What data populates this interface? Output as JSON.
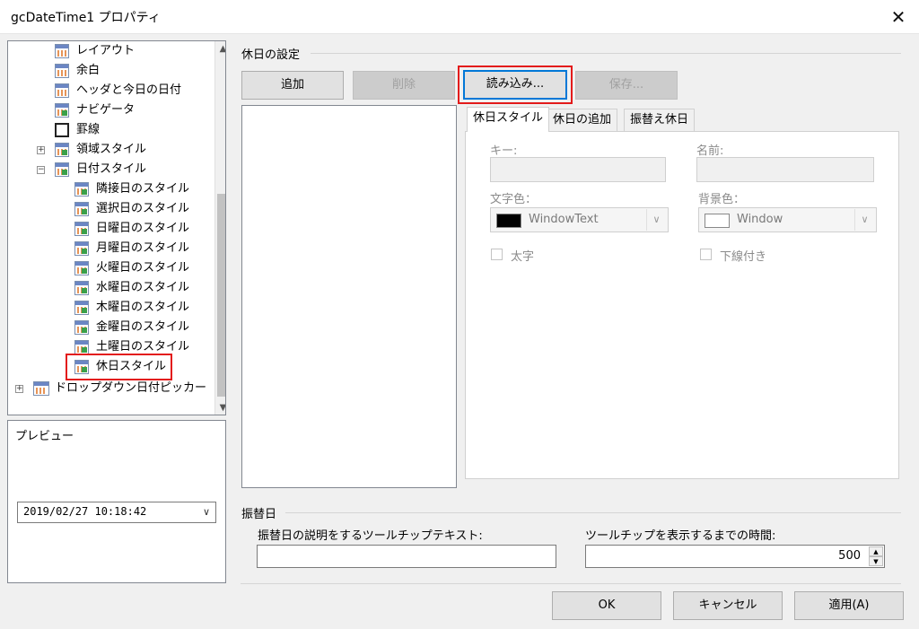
{
  "window": {
    "title": "gcDateTime1 プロパティ",
    "close_glyph": "✕"
  },
  "tree": {
    "items": [
      {
        "label": "レイアウト"
      },
      {
        "label": "余白"
      },
      {
        "label": "ヘッダと今日の日付"
      },
      {
        "label": "ナビゲータ"
      },
      {
        "label": "罫線"
      },
      {
        "label": "領域スタイル",
        "expander": "+"
      },
      {
        "label": "日付スタイル",
        "expander": "−"
      },
      {
        "label": "隣接日のスタイル"
      },
      {
        "label": "選択日のスタイル"
      },
      {
        "label": "日曜日のスタイル"
      },
      {
        "label": "月曜日のスタイル"
      },
      {
        "label": "火曜日のスタイル"
      },
      {
        "label": "水曜日のスタイル"
      },
      {
        "label": "木曜日のスタイル"
      },
      {
        "label": "金曜日のスタイル"
      },
      {
        "label": "土曜日のスタイル"
      },
      {
        "label": "休日スタイル"
      },
      {
        "label": "ドロップダウン日付ピッカー",
        "expander": "+"
      }
    ],
    "scroll_up": "▲",
    "scroll_down": "▼"
  },
  "preview": {
    "label": "プレビュー",
    "value": "2019/02/27 10:18:42",
    "arrow": "∨"
  },
  "holiday_settings": {
    "title": "休日の設定",
    "buttons": {
      "add": "追加",
      "delete": "削除",
      "load": "読み込み...",
      "save": "保存..."
    },
    "tabs": [
      "休日スタイル",
      "休日の追加",
      "振替え休日"
    ],
    "fields": {
      "key_label": "キー:",
      "name_label": "名前:",
      "forecolor_label": "文字色：",
      "forecolor_value": "WindowText",
      "forecolor_hex": "#000000",
      "backcolor_label": "背景色：",
      "backcolor_value": "Window",
      "backcolor_hex": "#ffffff",
      "bold_label": "太字",
      "underline_label": "下線付き",
      "combo_arrow": "∨"
    }
  },
  "substitute": {
    "title": "振替日",
    "tooltip_text_label": "振替日の説明をするツールチップテキスト:",
    "tooltip_text_value": "",
    "tooltip_delay_label": "ツールチップを表示するまでの時間:",
    "tooltip_delay_value": "500",
    "spin_up": "▲",
    "spin_down": "▼"
  },
  "footer": {
    "ok": "OK",
    "cancel": "キャンセル",
    "apply": "適用(A)"
  },
  "colors": {
    "highlight_red": "#e31b1b",
    "focus_blue": "#0078d7"
  }
}
